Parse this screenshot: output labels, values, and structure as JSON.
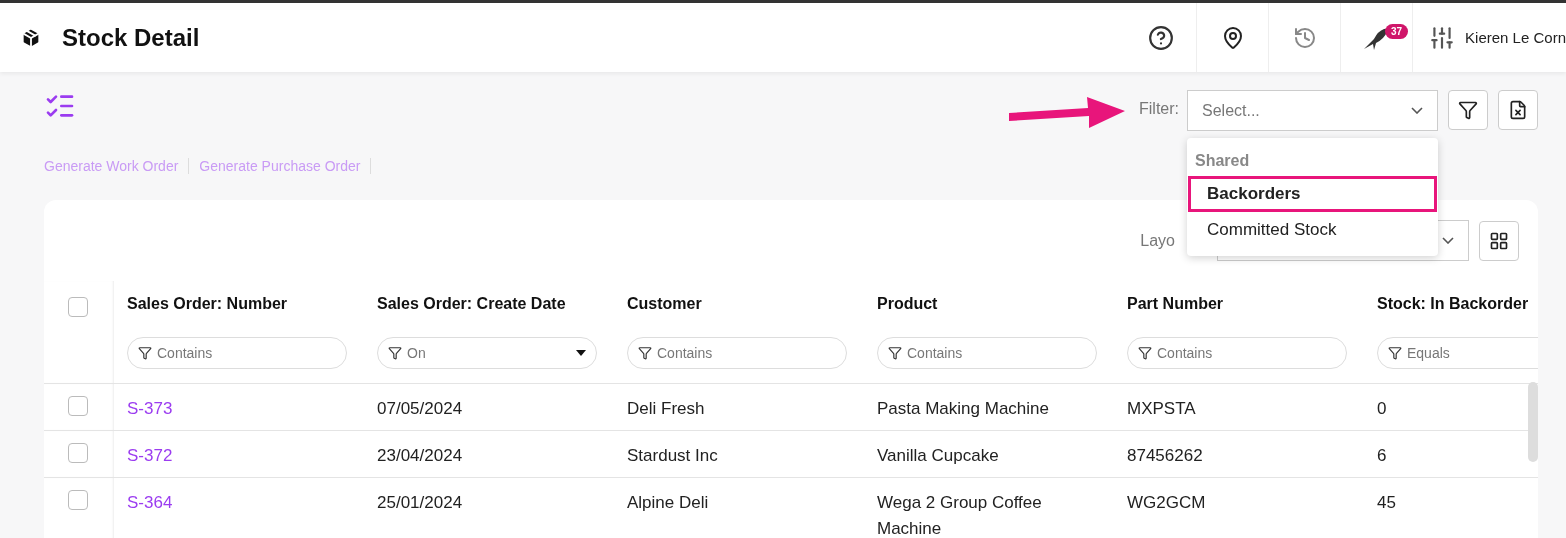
{
  "header": {
    "title": "Stock Detail",
    "notification_count": "37",
    "user_name": "Kieren Le Corn"
  },
  "actions": [
    "Generate Work Order",
    "Generate Purchase Order"
  ],
  "filter": {
    "label": "Filter:",
    "placeholder": "Select...",
    "expanded": true,
    "options": [
      {
        "kind": "group",
        "label": "Shared"
      },
      {
        "kind": "option",
        "label": "Backorders",
        "highlighted": true
      },
      {
        "kind": "option",
        "label": "Committed Stock",
        "highlighted": false
      }
    ]
  },
  "layout": {
    "label": "Layo"
  },
  "table": {
    "all_checked": false,
    "columns": [
      {
        "title": "Sales Order: Number",
        "filter": "Contains",
        "kind": "text"
      },
      {
        "title": "Sales Order: Create Date",
        "filter": "On",
        "kind": "select"
      },
      {
        "title": "Customer",
        "filter": "Contains",
        "kind": "text"
      },
      {
        "title": "Product",
        "filter": "Contains",
        "kind": "text"
      },
      {
        "title": "Part Number",
        "filter": "Contains",
        "kind": "text"
      },
      {
        "title": "Stock: In Backorder",
        "filter": "Equals",
        "kind": "text"
      }
    ],
    "rows": [
      {
        "checked": false,
        "cells": [
          "S-373",
          "07/05/2024",
          "Deli Fresh",
          "Pasta Making Machine",
          "MXPSTA",
          "0"
        ]
      },
      {
        "checked": false,
        "cells": [
          "S-372",
          "23/04/2024",
          "Stardust Inc",
          "Vanilla Cupcake",
          "87456262",
          "6"
        ]
      },
      {
        "checked": false,
        "cells": [
          "S-364",
          "25/01/2024",
          "Alpine Deli",
          "Wega 2 Group Coffee Machine",
          "WG2GCM",
          "45"
        ]
      }
    ]
  }
}
